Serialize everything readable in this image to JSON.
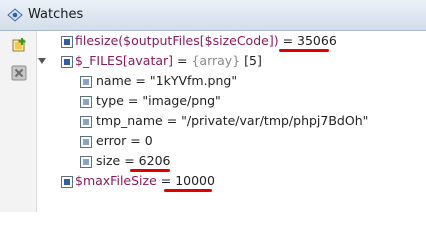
{
  "panel": {
    "title": "Watches"
  },
  "toolbar": {
    "add_icon": "add-watch-icon",
    "remove_icon": "remove-watch-icon"
  },
  "watches": {
    "row1": {
      "expr": "filesize($outputFiles[$sizeCode])",
      "eq": " = ",
      "value": "35066"
    },
    "row2": {
      "expr": "$_FILES[avatar]",
      "eq": " = ",
      "type": "{array}",
      "count": "[5]"
    },
    "children": {
      "name": {
        "key": "name",
        "eq": " = ",
        "value": "\"1kYVfm.png\""
      },
      "type": {
        "key": "type",
        "eq": " = ",
        "value": "\"image/png\""
      },
      "tmp_name": {
        "key": "tmp_name",
        "eq": " = ",
        "value": "\"/private/var/tmp/phpj7BdOh\""
      },
      "error": {
        "key": "error",
        "eq": " = ",
        "value": "0"
      },
      "size": {
        "key": "size",
        "eq": " = ",
        "value": "6206"
      }
    },
    "row3": {
      "expr": "$maxFileSize",
      "eq": " = ",
      "value": "10000"
    }
  },
  "colors": {
    "underline": "#e00000",
    "titlebar": "#d9e4ef"
  }
}
